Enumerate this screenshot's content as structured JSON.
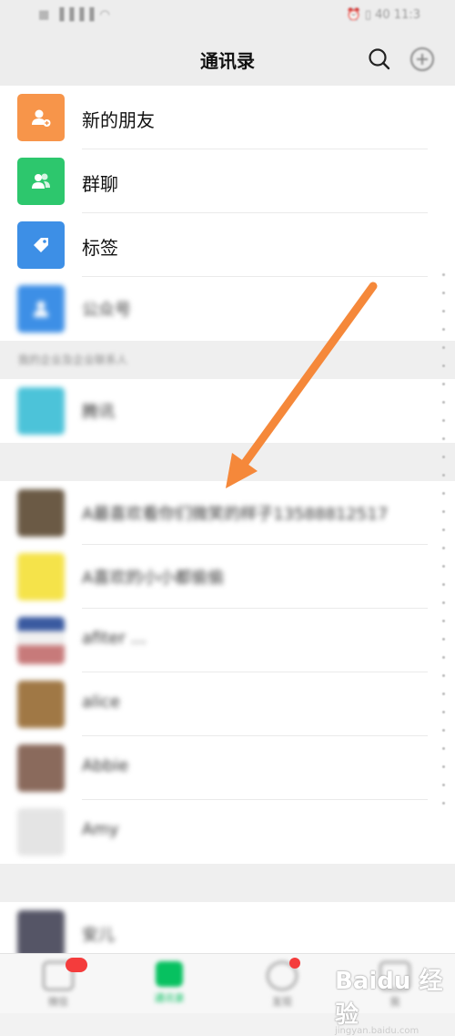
{
  "status": {
    "left": "▦ ▐▐▐▐ ◠",
    "right": "⏰ ▯ 40 11:3"
  },
  "header": {
    "title": "通讯录"
  },
  "menu": [
    {
      "label": "新的朋友",
      "color": "#f7954a",
      "icon": "add-friend-icon"
    },
    {
      "label": "群聊",
      "color": "#2dc76d",
      "icon": "group-chat-icon"
    },
    {
      "label": "标签",
      "color": "#3d8fe6",
      "icon": "tag-icon"
    },
    {
      "label": "公众号",
      "color": "#3d8fe6",
      "icon": "official-account-icon"
    }
  ],
  "sections": [
    {
      "label": "我的企业及企业联系人"
    },
    {
      "label": ""
    },
    {
      "label": ""
    }
  ],
  "contacts": [
    {
      "label": "A最喜欢看你们微笑的样子13588812517",
      "color": "#6b5a45"
    },
    {
      "label": "A喜欢的小小都偷偷",
      "color": "#f5e34a"
    },
    {
      "label": "afiter ...",
      "color": "#c77a7a"
    },
    {
      "label": "alice",
      "color": "#a07845"
    },
    {
      "label": "Abbie",
      "color": "#8a6a5c"
    },
    {
      "label": "Amy",
      "color": "#d8d8d8"
    },
    {
      "label": "安儿",
      "color": "#556"
    }
  ],
  "enterprise": {
    "label": "腾讯",
    "color": "#4cc3d9"
  },
  "tabs": [
    {
      "label": "微信",
      "icon": "chat-icon"
    },
    {
      "label": "通讯录",
      "icon": "contacts-icon"
    },
    {
      "label": "发现",
      "icon": "discover-icon"
    },
    {
      "label": "我",
      "icon": "me-icon"
    }
  ],
  "watermark": {
    "main": "Baidu 经验",
    "sub": "jingyan.baidu.com"
  },
  "colors": {
    "accent": "#07c160",
    "arrow": "#f5883a",
    "badge": "#f43c3c"
  }
}
